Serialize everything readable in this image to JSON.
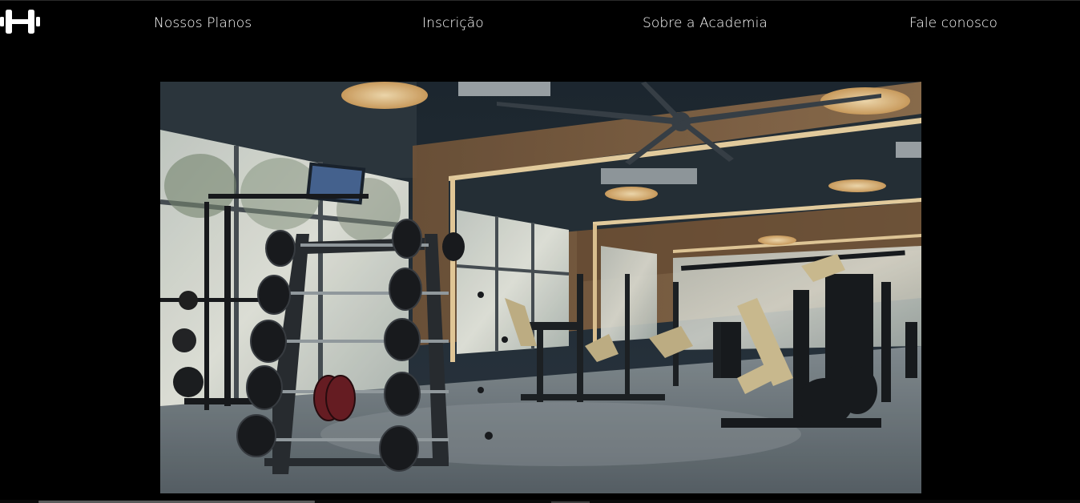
{
  "navbar": {
    "logo_icon": "dumbbell-icon",
    "links": [
      {
        "label": "Nossos Planos"
      },
      {
        "label": "Inscrição"
      },
      {
        "label": "Sobre a Academia"
      },
      {
        "label": "Fale conosco"
      }
    ]
  },
  "hero": {
    "image": "gym-interior-photo"
  },
  "colors": {
    "background": "#000000",
    "nav_text": "#ffffff"
  }
}
